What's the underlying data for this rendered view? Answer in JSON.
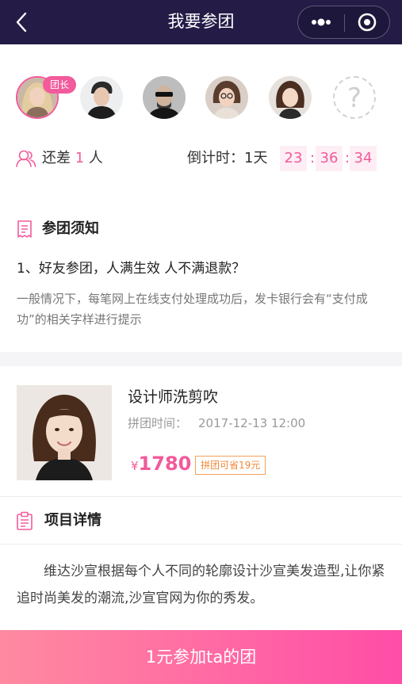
{
  "header": {
    "title": "我要参团",
    "back_icon": "chevron-left-icon",
    "more_icon": "more-dots-icon",
    "close_icon": "target-icon",
    "background": "#241c47"
  },
  "group": {
    "leader_badge": "团长",
    "members": [
      {
        "role": "leader"
      },
      {
        "role": "member"
      },
      {
        "role": "member"
      },
      {
        "role": "member"
      },
      {
        "role": "member"
      },
      {
        "role": "empty",
        "placeholder": "?"
      }
    ],
    "lack_prefix": "还差",
    "lack_count": "1",
    "lack_suffix": "人",
    "countdown_label": "倒计时：1天",
    "countdown": {
      "hours": "23",
      "minutes": "36",
      "seconds": "34",
      "separator": ":"
    }
  },
  "notice": {
    "title": "参团须知",
    "question": "1、好友参团，人满生效  人不满退款？",
    "description": "一般情况下，每笔网上在线支付处理成功后，发卡银行会有“支付成功”的相关字样进行提示"
  },
  "product": {
    "name": "设计师洗剪吹",
    "time_label": "拼团时间：",
    "time_value": "2017-12-13  12:00",
    "currency": "¥",
    "price": "1780",
    "save_badge": "拼团可省19元"
  },
  "detail": {
    "title": "项目详情",
    "text": "维达沙宣根据每个人不同的轮廓设计沙宣美发造型,让你紧追时尚美发的潮流,沙宣官网为你的秀发。"
  },
  "action": {
    "join_label": "1元参加ta的团"
  },
  "colors": {
    "accent": "#f25a9b",
    "orange": "#f08a3a",
    "button_start": "#ff8aa0",
    "button_end": "#ff4da7"
  }
}
